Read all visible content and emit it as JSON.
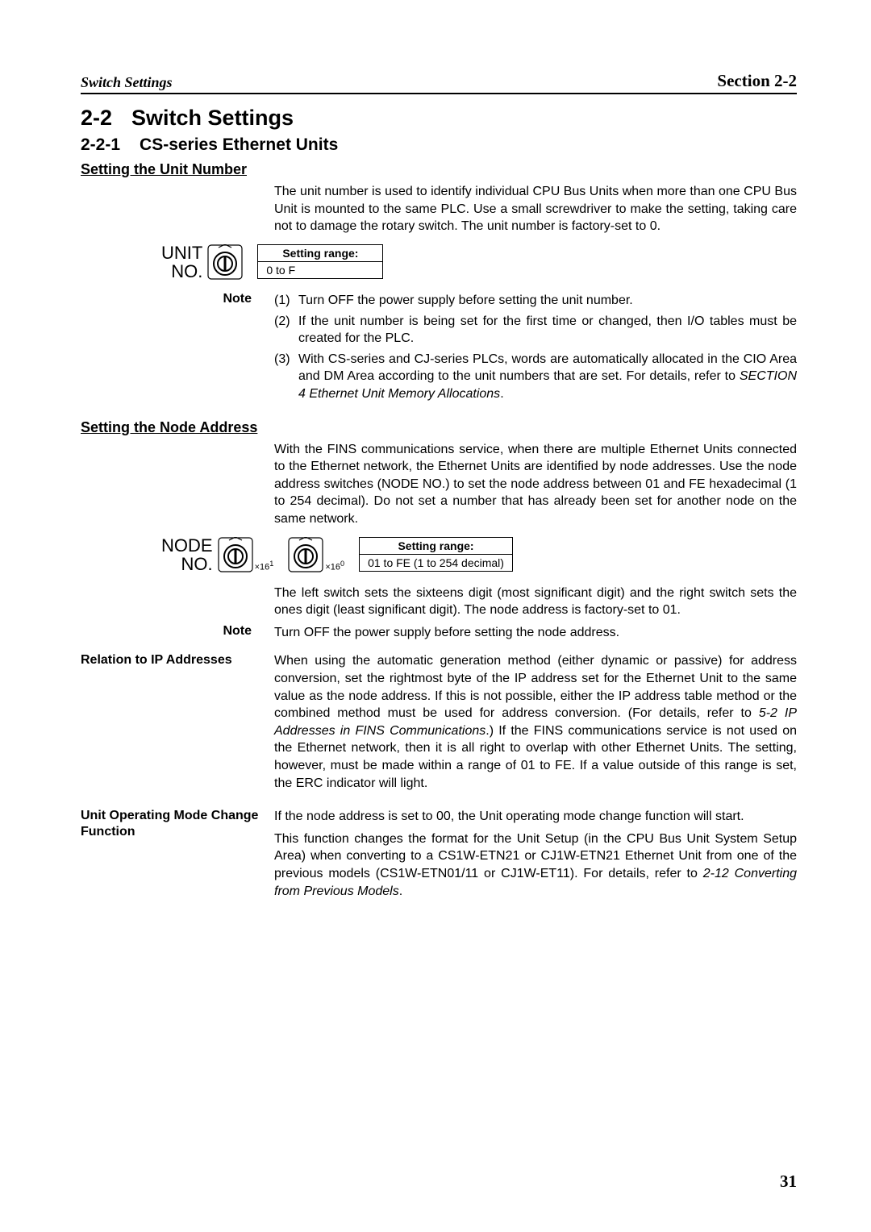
{
  "running_head": {
    "left": "Switch Settings",
    "right": "Section 2-2"
  },
  "h1": {
    "num": "2-2",
    "title": "Switch Settings"
  },
  "h2": {
    "num": "2-2-1",
    "title": "CS-series Ethernet Units"
  },
  "unit_number": {
    "heading": "Setting the Unit Number",
    "para": "The unit number is used to identify individual CPU Bus Units when more than one CPU Bus Unit is mounted to the same PLC. Use a small screwdriver to make the setting, taking care not to damage the rotary switch. The unit number is factory-set to 0.",
    "dial_label_1": "UNIT",
    "dial_label_2": "NO.",
    "range_header": "Setting range:",
    "range_value": "0 to F",
    "note_label": "Note",
    "notes": [
      {
        "n": "(1)",
        "text": "Turn OFF the power supply before setting the unit number."
      },
      {
        "n": "(2)",
        "text": "If the unit number is being set for the first time or changed, then I/O tables must be created for the PLC."
      },
      {
        "n": "(3)",
        "text": "With CS-series and CJ-series PLCs, words are automatically allocated in the CIO Area and DM Area according to the unit numbers that are set. For details, refer to ",
        "ref": "SECTION 4 Ethernet Unit Memory Allocations",
        "tail": "."
      }
    ]
  },
  "node_address": {
    "heading": "Setting the Node Address",
    "para1": "With the FINS communications service, when there are multiple Ethernet Units connected to the Ethernet network, the Ethernet Units are identified by node addresses. Use the node address switches (NODE NO.) to set the node address between 01 and FE hexadecimal (1 to 254 decimal). Do not set a number that has already been set for another node on the same network.",
    "dial_label_1": "NODE",
    "dial_label_2": "NO.",
    "sub_high": "×16",
    "sup_high": "1",
    "sub_low": "×16",
    "sup_low": "0",
    "range_header": "Setting range:",
    "range_value": "01 to FE (1 to 254 decimal)",
    "para2": "The left switch sets the sixteens digit (most significant digit) and the right switch sets the ones digit (least significant digit). The node address is factory-set to 01.",
    "note_label": "Note",
    "note_text": "Turn OFF the power supply before setting the node address."
  },
  "ip_relation": {
    "label": "Relation to IP Addresses",
    "text_a": "When using the automatic generation method (either dynamic or passive) for address conversion, set the rightmost byte of the IP address set for the Ethernet Unit to the same value as the node address. If this is not possible, either the IP address table method or the combined method must be used for address conversion. (For details, refer to ",
    "ref": "5-2 IP Addresses in FINS Communications",
    "text_b": ".) If the FINS communications service is not used on the Ethernet network, then it is all right to overlap with other Ethernet Units. The setting, however, must be made within a range of 01 to FE. If a value outside of this range is set, the ERC indicator will light."
  },
  "mode_change": {
    "label": "Unit Operating Mode Change Function",
    "p1": "If the node address is set to 00, the Unit operating mode change function will start.",
    "p2_a": "This function changes the format for the Unit Setup (in the CPU Bus Unit System Setup Area) when converting to a CS1W-ETN21 or CJ1W-ETN21 Ethernet Unit from one of the previous models (CS1W-ETN01/11 or CJ1W-ET11). For details, refer to ",
    "p2_ref": "2-12 Converting from Previous Models",
    "p2_b": "."
  },
  "page_number": "31"
}
